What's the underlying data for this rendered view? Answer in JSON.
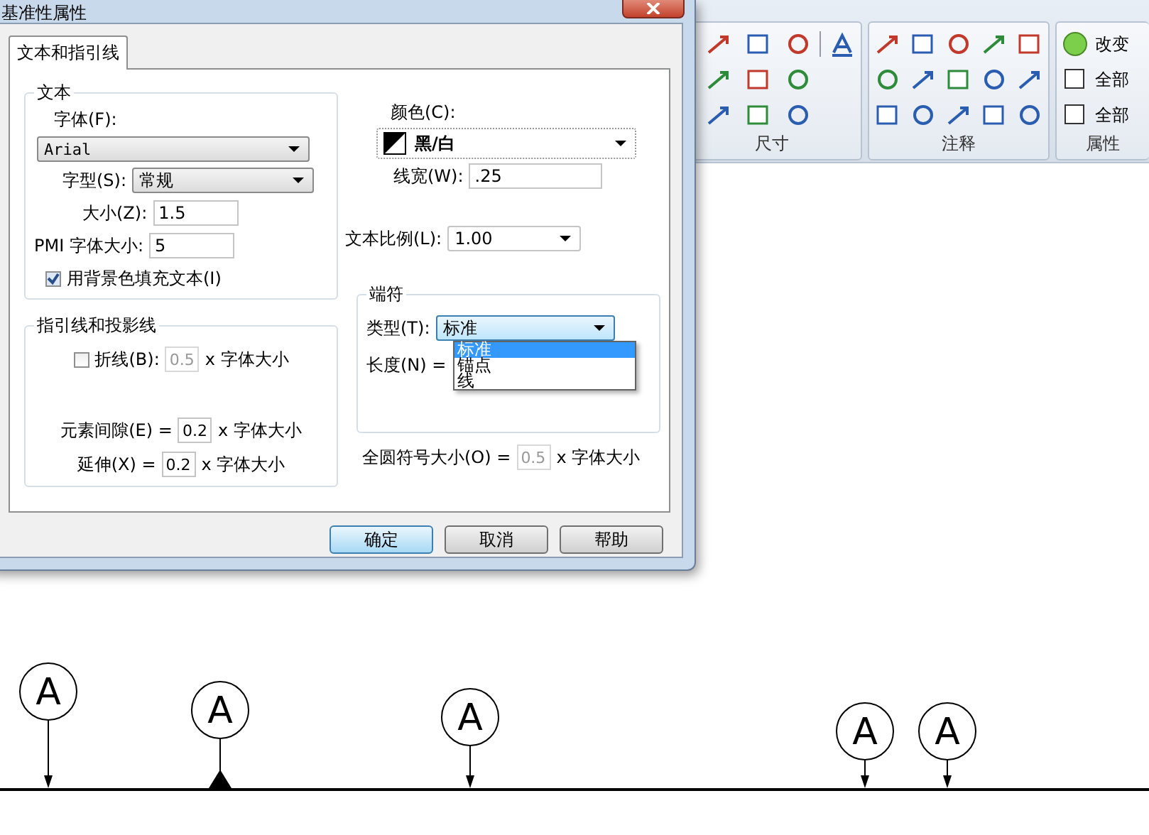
{
  "window": {
    "title": "基准性属性"
  },
  "tabs": [
    {
      "label": "文本和指引线",
      "selected": true
    }
  ],
  "text_group": {
    "title": "文本",
    "font": {
      "label": "字体(F):",
      "value": "Arial"
    },
    "style": {
      "label": "字型(S):",
      "value": "常规"
    },
    "size": {
      "label": "大小(Z):",
      "value": "1.5"
    },
    "pmi_size": {
      "label": "PMI 字体大小:",
      "value": "5"
    },
    "fill_background": {
      "label": "用背景色填充文本(I)",
      "checked": true
    }
  },
  "color": {
    "label": "颜色(C):",
    "value": "黑/白"
  },
  "line_width": {
    "label": "线宽(W):",
    "value": ".25"
  },
  "text_scale": {
    "label": "文本比例(L):",
    "value": "1.00"
  },
  "leader_group": {
    "title": "指引线和投影线",
    "rows": [
      {
        "kind": "checkbox",
        "label": "折线(B):",
        "checked": false,
        "value": "0.5",
        "disabled": true,
        "suffix": "x 字体大小"
      },
      {
        "kind": "field",
        "label": "元素间隙(E) =",
        "value": "0.2",
        "disabled": false,
        "suffix": "x 字体大小"
      },
      {
        "kind": "field",
        "label": "延伸(X) =",
        "value": "0.2",
        "disabled": false,
        "suffix": "x 字体大小"
      }
    ]
  },
  "terminator_group": {
    "title": "端符",
    "type": {
      "label": "类型(T):",
      "value": "标准",
      "expanded": true,
      "options": [
        {
          "label": "标准",
          "selected": true
        },
        {
          "label": "锚点",
          "selected": false
        },
        {
          "label": "线",
          "selected": false
        }
      ]
    },
    "length": {
      "label": "长度(N) ="
    }
  },
  "all_around": {
    "label": "全圆符号大小(O) =",
    "value": "0.5",
    "disabled": true,
    "suffix": "x 字体大小"
  },
  "buttons": [
    {
      "label": "确定",
      "default": true
    },
    {
      "label": "取消",
      "default": false
    },
    {
      "label": "帮助",
      "default": false
    }
  ],
  "ribbon": {
    "groups": [
      {
        "kind": "dimension",
        "label": "尺寸"
      },
      {
        "kind": "annotation",
        "label": "注释"
      },
      {
        "kind": "property",
        "label": "属性",
        "items": [
          "改变",
          "全部",
          "全部"
        ]
      }
    ]
  },
  "datum_features": [
    {
      "label": "A",
      "kind": "arrow"
    },
    {
      "label": "A",
      "kind": "triangle"
    },
    {
      "label": "A",
      "kind": "arrow"
    },
    {
      "label": "A",
      "kind": "arrow"
    },
    {
      "label": "A",
      "kind": "arrow"
    }
  ]
}
